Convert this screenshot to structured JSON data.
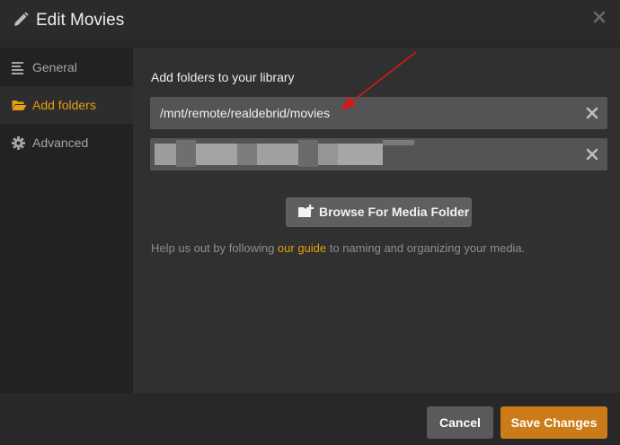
{
  "header": {
    "title": "Edit Movies",
    "title_icon": "pencil-icon",
    "close_icon": "close-icon"
  },
  "sidebar": {
    "items": [
      {
        "label": "General",
        "icon": "list-icon",
        "active": false
      },
      {
        "label": "Add folders",
        "icon": "folder-open-icon",
        "active": true
      },
      {
        "label": "Advanced",
        "icon": "gear-icon",
        "active": false
      }
    ]
  },
  "main": {
    "section_label": "Add folders to your library",
    "folders": [
      {
        "value": "/mnt/remote/realdebrid/movies"
      },
      {
        "value": ""
      }
    ],
    "browse_label": "Browse For Media Folder",
    "help": {
      "before": "Help us out by following ",
      "link": "our guide",
      "after": " to naming and organizing your media."
    }
  },
  "footer": {
    "cancel_label": "Cancel",
    "save_label": "Save Changes"
  },
  "colors": {
    "accent": "#e5a00d",
    "save": "#cc7b19",
    "annotation_arrow": "#d11a1a"
  }
}
